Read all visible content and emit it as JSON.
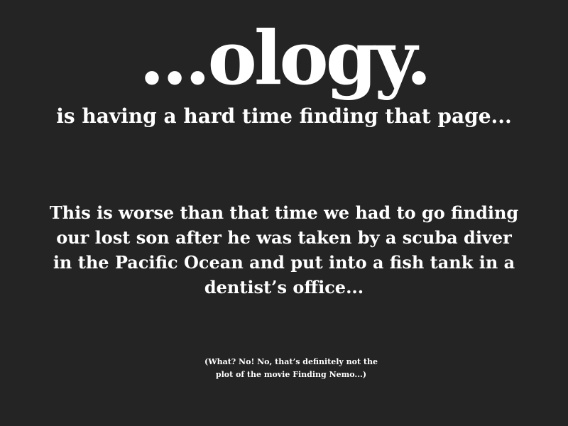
{
  "error_page": {
    "logo_text": "...ology.",
    "subtitle": "is having a hard time finding that page...",
    "message_lines": [
      "This is worse than that time we had to go finding",
      "our lost son after he was taken by a scuba diver",
      "in the Pacific Ocean and put into a fish tank in a",
      "dentist’s office..."
    ],
    "footnote_lines": [
      "(What? No! No, that’s definitely not the",
      "plot of the movie Finding Nemo...)"
    ]
  },
  "colors": {
    "background": "#242424",
    "text": "#ffffff"
  }
}
